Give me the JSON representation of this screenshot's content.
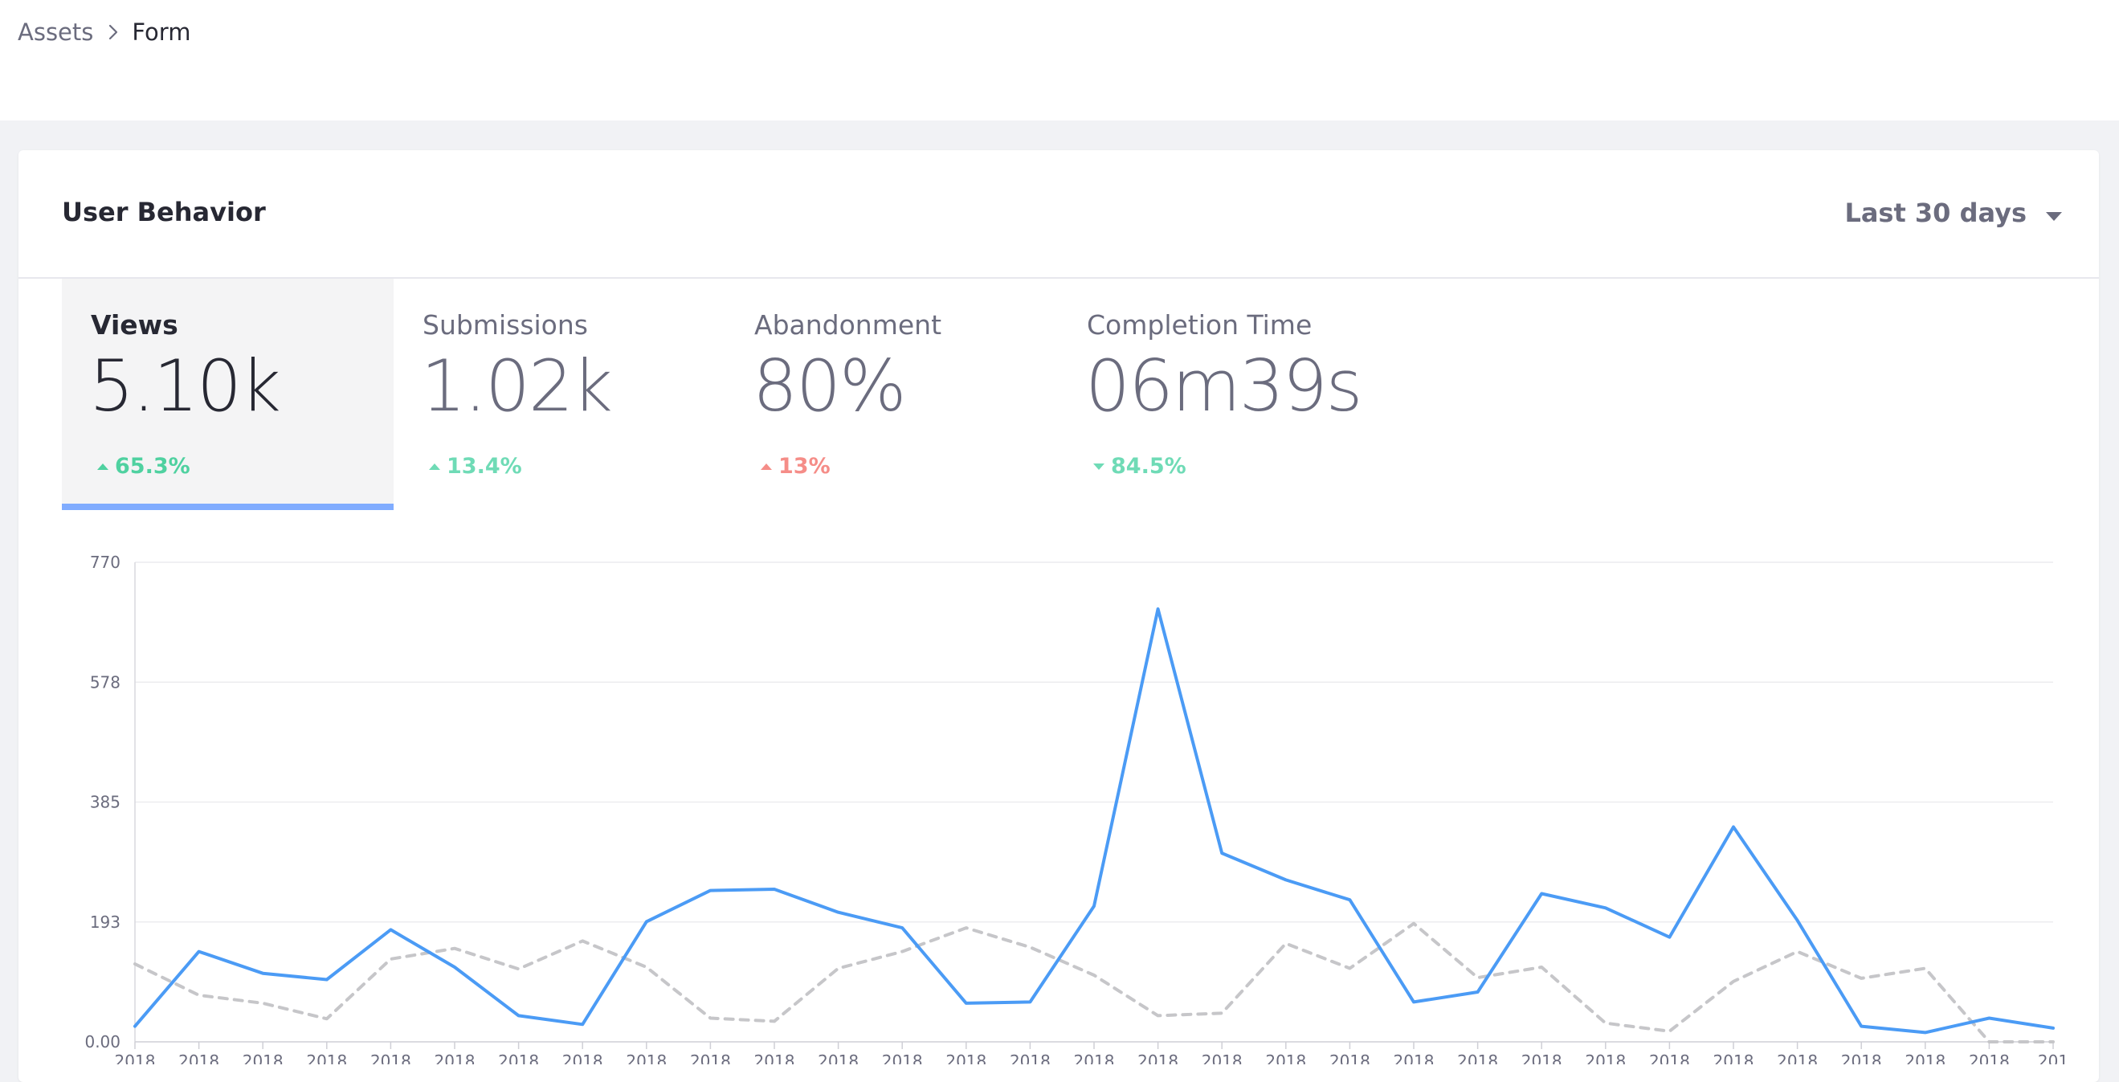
{
  "breadcrumb": {
    "items": [
      "Assets",
      "Form"
    ]
  },
  "card": {
    "title": "User Behavior",
    "range_label": "Last 30 days"
  },
  "metrics": [
    {
      "label": "Views",
      "value": "5.10k",
      "change": "65.3%",
      "direction": "up",
      "color": "#4fd1a0",
      "active": true
    },
    {
      "label": "Submissions",
      "value": "1.02k",
      "change": "13.4%",
      "direction": "up",
      "color": "#6fdbb6",
      "active": false
    },
    {
      "label": "Abandonment",
      "value": "80%",
      "change": "13%",
      "direction": "up",
      "color": "#f58d88",
      "active": false
    },
    {
      "label": "Completion Time",
      "value": "06m39s",
      "change": "84.5%",
      "direction": "down",
      "color": "#6fdbb6",
      "active": false
    }
  ],
  "colors": {
    "accent": "#80acff",
    "primary_line": "#4b9bf5",
    "comparison_line": "#c6c6c9"
  },
  "chart_data": {
    "type": "line",
    "x": [
      "2018",
      "2018",
      "2018",
      "2018",
      "2018",
      "2018",
      "2018",
      "2018",
      "2018",
      "2018",
      "2018",
      "2018",
      "2018",
      "2018",
      "2018",
      "2018",
      "2018",
      "2018",
      "2018",
      "2018",
      "2018",
      "2018",
      "2018",
      "2018",
      "2018",
      "2018",
      "2018",
      "2018",
      "2018",
      "2018",
      "201"
    ],
    "yticks": [
      "770",
      "578",
      "385",
      "193",
      "0.00"
    ],
    "ylim": [
      0,
      770
    ],
    "grid": true,
    "series": [
      {
        "values": [
          25,
          145,
          110,
          100,
          180,
          120,
          42,
          28,
          193,
          243,
          245,
          208,
          183,
          62,
          64,
          218,
          695,
          303,
          260,
          228,
          64,
          80,
          238,
          215,
          168,
          345,
          195,
          25,
          15,
          38,
          22
        ],
        "style": "solid"
      },
      {
        "values": [
          125,
          75,
          62,
          37,
          133,
          150,
          117,
          162,
          120,
          38,
          33,
          118,
          145,
          183,
          152,
          107,
          42,
          46,
          158,
          118,
          190,
          103,
          120,
          30,
          17,
          97,
          145,
          102,
          118,
          0,
          0
        ],
        "style": "dashed"
      }
    ]
  }
}
